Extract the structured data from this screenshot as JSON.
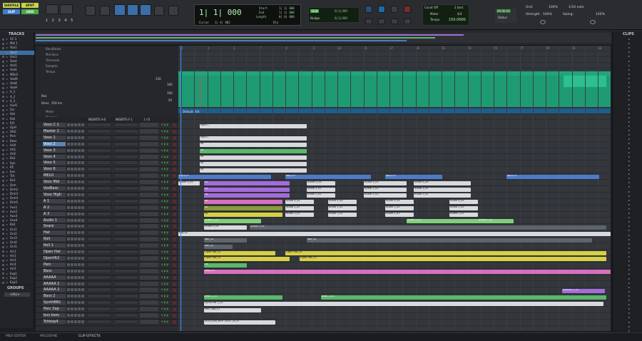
{
  "toolbar": {
    "modes": [
      "SHUFFLE",
      "SPOT",
      "SLIP",
      "GRID"
    ],
    "numbers": [
      "1",
      "2",
      "3",
      "4",
      "5"
    ],
    "counter": {
      "main": "1| 1| 000",
      "cursor_label": "Cursor",
      "cursor_value": "1| 4| 802",
      "start_label": "Start",
      "end_label": "End",
      "length_label": "Length",
      "start": "1| 1| 000",
      "end": "1| 1| 000",
      "length": "0| 0| 000",
      "dly_label": "Dly"
    },
    "nudge": {
      "grid_label": "Grid",
      "grid_value": "0| 1| 000",
      "nudge_label": "Nudge",
      "nudge_value": "0| 1| 000"
    },
    "countoff": {
      "count_off": "Count Off",
      "bars": "2 bars",
      "meter_label": "Meter",
      "meter": "4/4",
      "tempo_label": "Tempo",
      "tempo": "150.0000"
    },
    "status": {
      "value": "00:00:00",
      "label": "Status"
    },
    "grid_right": {
      "grid_label": "Grid",
      "grid_pct": "100%",
      "note": "1/16 note",
      "strength_label": "Strength:",
      "strength": "100%",
      "swing_label": "Swing:",
      "swing": "100%"
    }
  },
  "panels": {
    "tracks": "TRACKS",
    "groups": "GROUPS",
    "all": "<ALL>",
    "clips": "CLIPS"
  },
  "rulers": [
    {
      "label": "Bars|Beats"
    },
    {
      "label": "Min:Secs"
    },
    {
      "label": "Timecode"
    },
    {
      "label": "Samples"
    },
    {
      "label": "Tempo"
    },
    {
      "label": "Meter"
    },
    {
      "label": "Markers"
    }
  ],
  "bar_numbers": [
    "1",
    "3",
    "5",
    "7",
    "9",
    "11",
    "13",
    "15",
    "17",
    "19",
    "21",
    "23",
    "25",
    "27",
    "29",
    "31",
    "33"
  ],
  "tempo_values": {
    "bpm": "150",
    "v100a": "100",
    "v100b": "100",
    "v50": "50",
    "res_label": "Res:",
    "dens_label": "Dens:",
    "dens": "250 ms",
    "default_meter": "Default: 4/4"
  },
  "header_cols": {
    "inserts_ae": "INSERTS A-E",
    "inserts_fj": "INSERTS F-J",
    "io": "I / O"
  },
  "tracks": [
    {
      "name": "Voxx C 1",
      "sel": false
    },
    {
      "name": "Master 1",
      "sel": false
    },
    {
      "name": "Voxx 1",
      "sel": false
    },
    {
      "name": "Voxx 2",
      "sel": true
    },
    {
      "name": "Voxx 3",
      "sel": false
    },
    {
      "name": "Voxx 4",
      "sel": false
    },
    {
      "name": "Voxx 5",
      "sel": false
    },
    {
      "name": "Voxx 6",
      "sel": false
    },
    {
      "name": "MELO",
      "sel": false
    },
    {
      "name": "Voxx Mid",
      "sel": false
    },
    {
      "name": "VoxBass",
      "sel": false
    },
    {
      "name": "Voxx High",
      "sel": false
    },
    {
      "name": "A 1",
      "sel": false
    },
    {
      "name": "A 2",
      "sel": false
    },
    {
      "name": "A 3",
      "sel": false
    },
    {
      "name": "Audio 1",
      "sel": false
    },
    {
      "name": "Snare",
      "sel": false
    },
    {
      "name": "Hat",
      "sel": false
    },
    {
      "name": "Roll",
      "sel": false
    },
    {
      "name": "Roll 1",
      "sel": false
    },
    {
      "name": "Open Hat",
      "sel": false
    },
    {
      "name": "OpenHt2",
      "sel": false
    },
    {
      "name": "Perc",
      "sel": false
    },
    {
      "name": "Bass",
      "sel": false
    },
    {
      "name": "AAAAA",
      "sel": false
    },
    {
      "name": "AAAAA 1",
      "sel": false
    },
    {
      "name": "AAAAA 2",
      "sel": false
    },
    {
      "name": "Bass 2",
      "sel": false
    },
    {
      "name": "SynthBB1",
      "sel": false
    },
    {
      "name": "Perc Zap",
      "sel": false
    },
    {
      "name": "bus bass",
      "sel": false
    },
    {
      "name": "Tchbxp4",
      "sel": false
    }
  ],
  "tracklist_names": [
    "VC 1",
    "Mst 1",
    "Vox1",
    "Vox2",
    "Vox3",
    "Vox4",
    "Vox5",
    "Vox6",
    "MELO",
    "VoxM",
    "VoxB",
    "VoxH",
    "A_1",
    "A_2",
    "A_3",
    "Aud1",
    "Snr",
    "Hat",
    "Roll",
    "Rl1",
    "OpH",
    "OH2",
    "Perc",
    "Bass",
    "AAA",
    "AA1",
    "AA2",
    "Bs2",
    "Syn",
    "PZ",
    "bus",
    "Tch",
    "Bs3",
    "Drm",
    "Drm2",
    "Drm3",
    "Drm4",
    "Drm5",
    "Aux1",
    "Aux2",
    "Aux3",
    "Aux4",
    "Bs4",
    "Grv1",
    "Grv2",
    "Grv3",
    "Grv4",
    "Grv5",
    "Arr1",
    "Arr2",
    "Arr3",
    "Arr4",
    "Arr5",
    "Exp1",
    "Exp2",
    "Exp3"
  ],
  "clip_labels": {
    "vc": "Voxx C",
    "vo": "Vo",
    "mel": "MELO-P",
    "snare": "Snare 9_05",
    "audio": "Audio 1_02",
    "hat": "Hat_02",
    "roll": "Roll_01",
    "openhat": "Open Hat_01",
    "bass": "Bass_01",
    "aaaaa": "AAAAA_2-03",
    "bass2": "Bass 2_01",
    "synth": "Synth BB 1_01",
    "perczap": "Perc Zap_01",
    "tch": "2025_sun_MOF 2025 _v3_9"
  },
  "bottom": {
    "midi": "MIDI EDITOR",
    "melodyne": "MELODYNE",
    "clip_effects": "CLIP EFFECTS"
  },
  "colors": {
    "accent": "#3b8cff",
    "tempo": "#1e9b73",
    "selected": "#5a86b8"
  }
}
